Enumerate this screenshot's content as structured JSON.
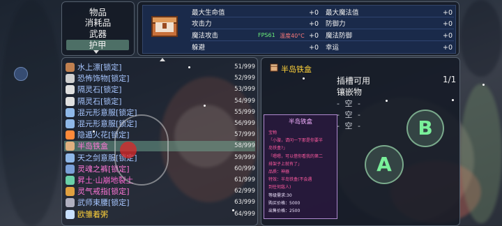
{
  "categories": [
    {
      "label": "物品",
      "selected": false
    },
    {
      "label": "消耗品",
      "selected": false
    },
    {
      "label": "武器",
      "selected": false
    },
    {
      "label": "护甲",
      "selected": true
    }
  ],
  "stats": {
    "rows": [
      {
        "left_label": "最大生命值",
        "left_value": "+0",
        "right_label": "最大魔法值",
        "right_value": "+0"
      },
      {
        "left_label": "攻击力",
        "left_value": "+0",
        "right_label": "防御力",
        "right_value": "+0"
      },
      {
        "left_label": "魔法攻击",
        "left_value": "+0",
        "right_label": "魔法防御",
        "right_value": "+0"
      },
      {
        "left_label": "躲避",
        "left_value": "+0",
        "right_label": "幸运",
        "right_value": "+0"
      }
    ],
    "fps": "FPS61",
    "temperature": "温度40°C"
  },
  "items": [
    {
      "name": "水上漂[锁定]",
      "count": "51/999",
      "color": "#a7c6ff",
      "icon": "boot-icon",
      "selected": false
    },
    {
      "name": "恐怖饰物[锁定]",
      "count": "52/999",
      "color": "#a7c6ff",
      "icon": "mask-icon",
      "selected": false
    },
    {
      "name": "隔灵石[锁定]",
      "count": "53/999",
      "color": "#a7c6ff",
      "icon": "stone-icon",
      "selected": false
    },
    {
      "name": "隔灵石[锁定]",
      "count": "54/999",
      "color": "#a7c6ff",
      "icon": "stone-icon",
      "selected": false
    },
    {
      "name": "混元形意服[锁定]",
      "count": "55/999",
      "color": "#a7c6ff",
      "icon": "robe-icon",
      "selected": false
    },
    {
      "name": "混元形意服[锁定]",
      "count": "56/999",
      "color": "#a7c6ff",
      "icon": "robe-icon",
      "selected": false
    },
    {
      "name": "隐遁火花[锁定]",
      "count": "57/999",
      "color": "#a7c6ff",
      "icon": "spark-icon",
      "selected": false
    },
    {
      "name": "半岛铁盒",
      "count": "58/999",
      "color": "#ff77d8",
      "icon": "box-icon",
      "selected": true
    },
    {
      "name": "天之剑意服[锁定]",
      "count": "59/999",
      "color": "#a7c6ff",
      "icon": "robe-icon",
      "selected": false
    },
    {
      "name": "灵魂之裤[锁定]",
      "count": "60/999",
      "color": "#ff77d8",
      "icon": "pants-icon",
      "selected": false
    },
    {
      "name": "昇土·山崩地裂土",
      "count": "61/999",
      "color": "#ff6ad5",
      "icon": "dirt-icon",
      "selected": false
    },
    {
      "name": "灵气戒指[锁定]",
      "count": "62/999",
      "color": "#ff77d8",
      "icon": "ring-icon",
      "selected": false
    },
    {
      "name": "武师束腰[锁定]",
      "count": "63/999",
      "color": "#a7c6ff",
      "icon": "belt-icon",
      "selected": false
    },
    {
      "name": "欧雏着粥",
      "count": "64/999",
      "color": "#ffd23a",
      "icon": "feather-icon",
      "selected": false
    }
  ],
  "detail": {
    "title": "半岛铁盒",
    "slot_label_1": "插槽可用",
    "slot_label_2": "镶嵌物",
    "slot_count": "1/1",
    "empty_slots": [
      "- 空 -",
      "- 空 -",
      "- 空 -"
    ]
  },
  "tooltip": {
    "title": "半岛铁盒",
    "lines": [
      {
        "text": "宝物",
        "white": false
      },
      {
        "text": "「小璇，请问一下那是你要半",
        "white": false
      },
      {
        "text": "岛铁盒?」",
        "white": false
      },
      {
        "text": "「嗯嗯，可以借你看我的第二",
        "white": false
      },
      {
        "text": "排架子上就有了」",
        "white": false
      },
      {
        "text": "品质：神器",
        "white": false
      },
      {
        "text": "特效：半岛铁盒(不会遇",
        "white": false
      },
      {
        "text": "到任何敌人)",
        "white": false
      },
      {
        "text": "等级需求:30",
        "white": true
      },
      {
        "text": "购买价格：5000",
        "white": true
      },
      {
        "text": "出售价格：2500",
        "white": true
      }
    ]
  },
  "buttons": {
    "a_label": "A",
    "b_label": "B"
  },
  "colors": {
    "selected_category": "#4d6f66",
    "legendary": "#ff77d8",
    "normal": "#a7c6ff",
    "gold": "#ffd23a"
  }
}
